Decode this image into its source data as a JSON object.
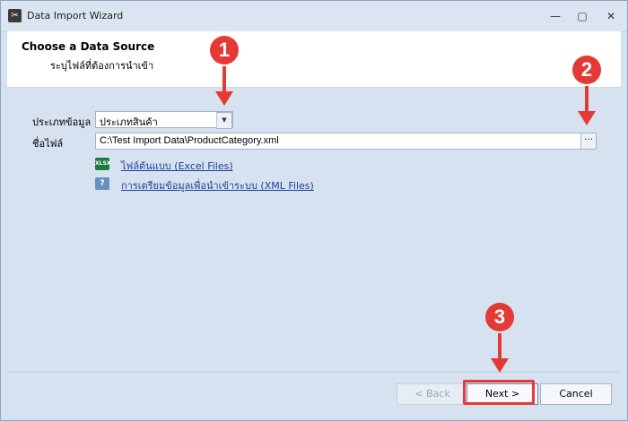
{
  "window": {
    "title": "Data Import Wizard",
    "icon": "wizard-tool-icon",
    "controls": {
      "minimize": "minimize-icon",
      "maximize": "maximize-icon",
      "close": "close-icon"
    }
  },
  "header": {
    "title": "Choose a Data Source",
    "subtitle": "ระบุไฟล์ที่ต้องการนำเข้า"
  },
  "form": {
    "data_type_label": "ประเภทข้อมูล",
    "data_type_value": "ประเภทสินค้า",
    "file_label": "ชื่อไฟล์",
    "file_path": "C:\\Test Import Data\\ProductCategory.xml",
    "browse_label": "···"
  },
  "links": [
    {
      "label": "ไฟล์ต้นแบบ (Excel Files)",
      "icon": "excel-file-icon",
      "icon_text": "XLSX"
    },
    {
      "label": "การเตรียมข้อมูลเพื่อนำเข้าระบบ (XML Files)",
      "icon": "help-document-icon",
      "icon_text": "?"
    }
  ],
  "footer": {
    "back_label": "< Back",
    "next_label": "Next >",
    "cancel_label": "Cancel"
  },
  "annotations": {
    "marker_1": "1",
    "marker_2": "2",
    "marker_3": "3",
    "color": "#e53935"
  }
}
